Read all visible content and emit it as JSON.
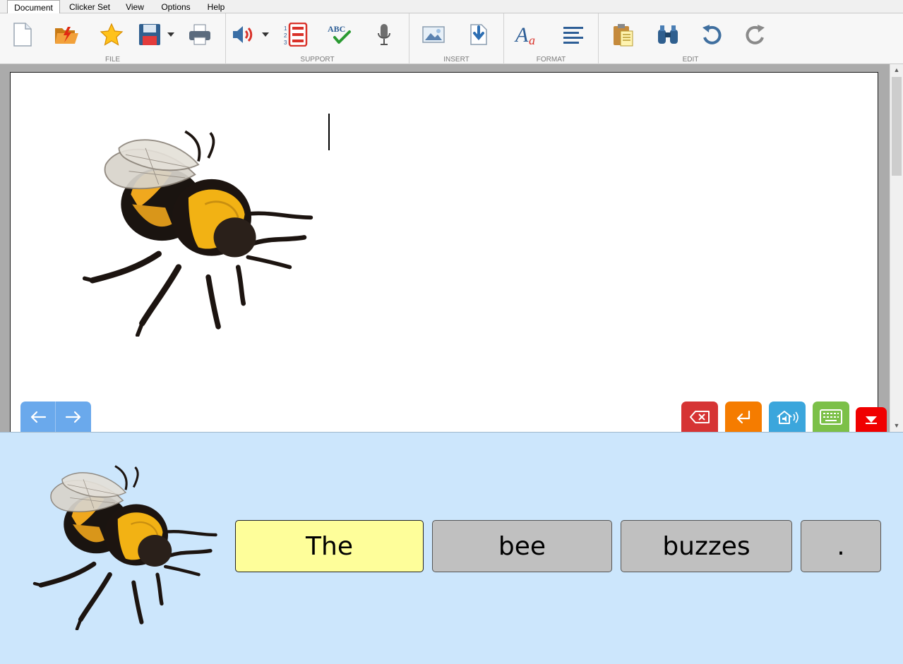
{
  "menu": {
    "tabs": [
      "Document",
      "Clicker Set",
      "View",
      "Options",
      "Help"
    ],
    "active_tab": "Document"
  },
  "ribbon": {
    "groups": [
      {
        "label": "FILE",
        "icons": [
          "new-document-icon",
          "open-folder-icon",
          "favorite-star-icon",
          "save-disk-icon",
          "print-icon"
        ]
      },
      {
        "label": "SUPPORT",
        "icons": [
          "speech-volume-icon",
          "numbered-list-icon",
          "spellcheck-icon",
          "microphone-icon"
        ]
      },
      {
        "label": "INSERT",
        "icons": [
          "insert-picture-icon",
          "insert-file-icon"
        ]
      },
      {
        "label": "FORMAT",
        "icons": [
          "font-style-icon",
          "align-left-icon"
        ]
      },
      {
        "label": "EDIT",
        "icons": [
          "paste-clipboard-icon",
          "find-binoculars-icon",
          "undo-icon",
          "redo-icon"
        ]
      }
    ],
    "spellcheck_text": "ABC",
    "font_letters": {
      "big": "A",
      "small": "a"
    }
  },
  "document": {
    "image": "bumblebee-picture",
    "text": ""
  },
  "controls": {
    "nav": [
      "arrow-left-icon",
      "arrow-right-icon"
    ],
    "actions": [
      {
        "name": "backspace",
        "color": "#d63434"
      },
      {
        "name": "enter",
        "color": "#f57c00"
      },
      {
        "name": "speak-home",
        "color": "#3ba6dc"
      },
      {
        "name": "keyboard",
        "color": "#7cc048"
      },
      {
        "name": "minimize",
        "color": "#f00000"
      }
    ]
  },
  "clicker": {
    "image": "bumblebee-picture",
    "cells": [
      "The",
      "bee",
      "buzzes",
      "."
    ],
    "selected_index": 0,
    "colors": {
      "panel": "#cce6fc",
      "selected": "#fefe9a",
      "cell": "#c0c0c0"
    }
  }
}
